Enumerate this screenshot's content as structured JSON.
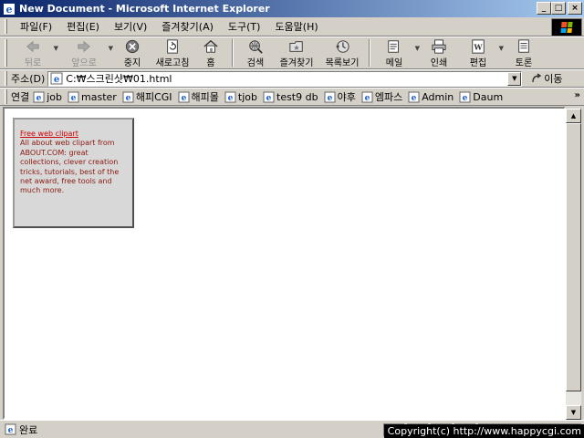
{
  "window": {
    "title": "New Document - Microsoft Internet Explorer",
    "minimize_glyph": "_",
    "maximize_glyph": "□",
    "close_glyph": "×"
  },
  "menu": {
    "items": [
      "파일(F)",
      "편집(E)",
      "보기(V)",
      "즐겨찾기(A)",
      "도구(T)",
      "도움말(H)"
    ]
  },
  "toolbar": {
    "back": "뒤로",
    "forward": "앞으로",
    "stop": "중지",
    "refresh": "새로고침",
    "home": "홈",
    "search": "검색",
    "favorites": "즐겨찾기",
    "history": "목록보기",
    "mail": "메일",
    "print": "인쇄",
    "edit": "편집",
    "discuss": "토론"
  },
  "address": {
    "label": "주소(D)",
    "url": "C:₩스크린샷₩01.html",
    "go": "이동"
  },
  "links": {
    "label": "연결",
    "items": [
      "job",
      "master",
      "해피CGI",
      "해피몰",
      "tjob",
      "test9 db",
      "야후",
      "엠파스",
      "Admin",
      "Daum"
    ],
    "more": "»"
  },
  "content": {
    "clip_link": "Free web clipart",
    "clip_text": "All about web clipart from ABOUT.COM: great collections, clever creation tricks, tutorials, best of the net award, free tools and much more."
  },
  "status": {
    "text": "완료",
    "copyright": "Copyright(c) http://www.happycgi.com"
  },
  "colors": {
    "titlebar_start": "#0a246a",
    "titlebar_end": "#a6caf0",
    "link_red": "#cc0000",
    "clip_text": "#8a1a10"
  }
}
